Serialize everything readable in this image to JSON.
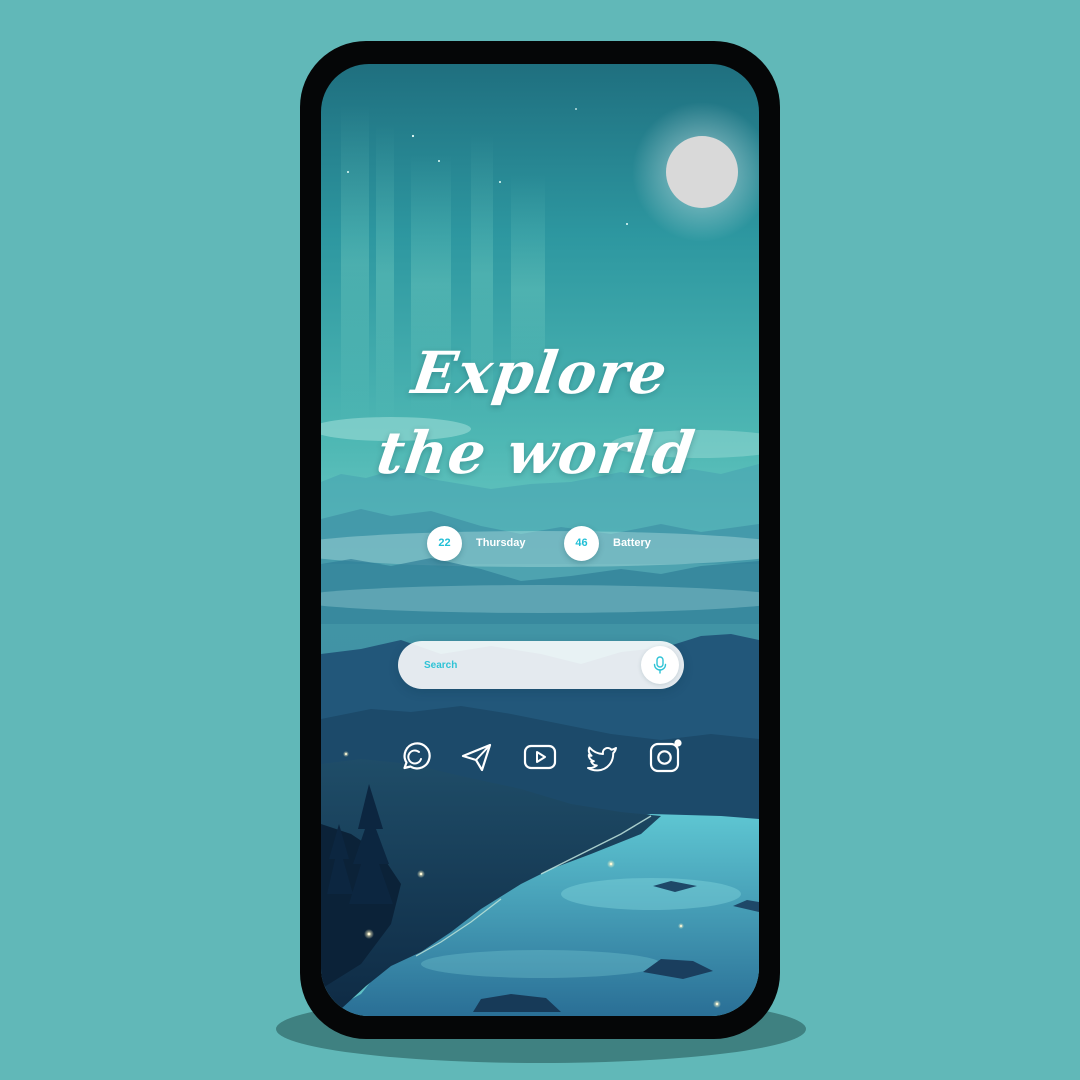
{
  "home": {
    "headline_line1": "Explore",
    "headline_line2": "the world",
    "date_number": "22",
    "date_day": "Thursday",
    "battery_level": "46",
    "battery_label": "Battery",
    "search_placeholder": "Search"
  },
  "icons": {
    "mic": "microphone-icon",
    "apps": [
      "whatsapp-icon",
      "telegram-icon",
      "youtube-icon",
      "twitter-icon",
      "instagram-icon"
    ]
  },
  "colors": {
    "background": "#61b8b8",
    "phone_frame": "#050607",
    "accent": "#22bfd6",
    "text": "#ffffff"
  }
}
